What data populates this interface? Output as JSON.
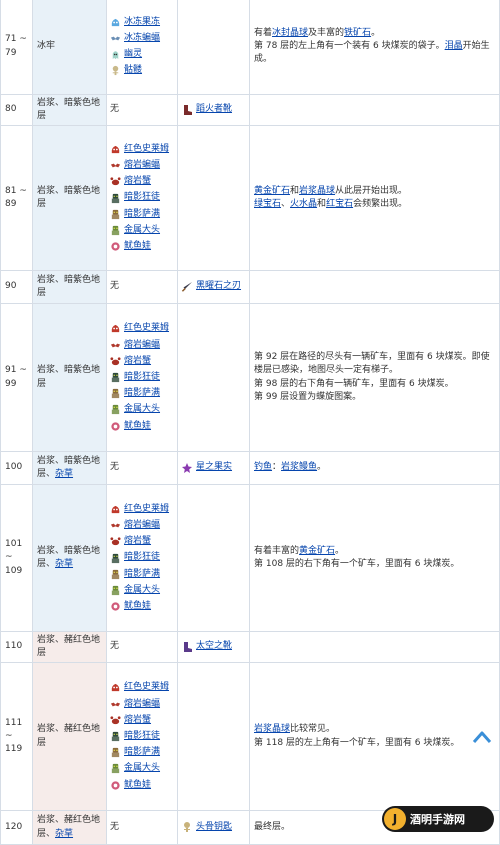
{
  "rows": [
    {
      "floor": "71 ~ 79",
      "layer": "冰牢",
      "layer_links": [],
      "enemies": [
        {
          "icon": "ice-jelly-icon",
          "name": "冰冻果冻",
          "color": "#5aa8e0"
        },
        {
          "icon": "ice-bat-icon",
          "name": "冰冻蝙蝠",
          "color": "#6b8fb5"
        },
        {
          "icon": "ghost-icon",
          "name": "幽灵",
          "color": "#9fd3c8"
        },
        {
          "icon": "skeleton-icon",
          "name": "骷髅",
          "color": "#c9b98a"
        }
      ],
      "item": null,
      "notes": [
        [
          {
            "t": "有着"
          },
          {
            "t": "冰封晶球",
            "link": true
          },
          {
            "t": "及丰富的"
          },
          {
            "t": "铁矿石",
            "link": true
          },
          {
            "t": "。"
          }
        ],
        [
          {
            "t": "第 78 层的左上角有一个装有 6 块煤炭的袋子。"
          },
          {
            "t": "泪晶",
            "link": true
          },
          {
            "t": "开始生成。"
          }
        ]
      ]
    },
    {
      "floor": "80",
      "layer": "岩浆、暗紫色地层",
      "layer_links": [],
      "enemies": [],
      "none_text": "无",
      "item": {
        "icon": "fire-boots-icon",
        "name": "蹈火者靴",
        "color": "#7a2a2a"
      },
      "notes": []
    },
    {
      "floor": "81 ~ 89",
      "layer": "岩浆、暗紫色地层",
      "layer_links": [],
      "enemies": [
        {
          "icon": "red-slime-icon",
          "name": "红色史莱姆",
          "color": "#c0392b"
        },
        {
          "icon": "lava-bat-icon",
          "name": "熔岩蝙蝠",
          "color": "#b03a2e"
        },
        {
          "icon": "lava-crab-icon",
          "name": "熔岩蟹",
          "color": "#a93226"
        },
        {
          "icon": "shadow-brute-icon",
          "name": "暗影狂徒",
          "color": "#2e4a3a"
        },
        {
          "icon": "shadow-shaman-icon",
          "name": "暗影萨满",
          "color": "#8a6a3a"
        },
        {
          "icon": "metal-head-icon",
          "name": "金属大头",
          "color": "#6a8a3a"
        },
        {
          "icon": "squidkid-icon",
          "name": "鱿鱼娃",
          "color": "#d05a7a"
        }
      ],
      "item": null,
      "notes": [
        [
          {
            "t": "黄金矿石",
            "link": true
          },
          {
            "t": "和"
          },
          {
            "t": "岩浆晶球",
            "link": true
          },
          {
            "t": "从此层开始出现。"
          }
        ],
        [
          {
            "t": "绿宝石",
            "link": true
          },
          {
            "t": "、"
          },
          {
            "t": "火水晶",
            "link": true
          },
          {
            "t": "和"
          },
          {
            "t": "红宝石",
            "link": true
          },
          {
            "t": "会频繁出现。"
          }
        ]
      ]
    },
    {
      "floor": "90",
      "layer": "岩浆、暗紫色地层",
      "layer_links": [],
      "enemies": [],
      "none_text": "无",
      "item": {
        "icon": "obsidian-blade-icon",
        "name": "黑曜石之刃",
        "color": "#3a3a4a"
      },
      "notes": []
    },
    {
      "floor": "91 ~ 99",
      "layer": "岩浆、暗紫色地层",
      "layer_links": [],
      "enemies": [
        {
          "icon": "red-slime-icon",
          "name": "红色史莱姆",
          "color": "#c0392b"
        },
        {
          "icon": "lava-bat-icon",
          "name": "熔岩蝙蝠",
          "color": "#b03a2e"
        },
        {
          "icon": "lava-crab-icon",
          "name": "熔岩蟹",
          "color": "#a93226"
        },
        {
          "icon": "shadow-brute-icon",
          "name": "暗影狂徒",
          "color": "#2e4a3a"
        },
        {
          "icon": "shadow-shaman-icon",
          "name": "暗影萨满",
          "color": "#8a6a3a"
        },
        {
          "icon": "metal-head-icon",
          "name": "金属大头",
          "color": "#6a8a3a"
        },
        {
          "icon": "squidkid-icon",
          "name": "鱿鱼娃",
          "color": "#d05a7a"
        }
      ],
      "item": null,
      "notes": [
        [
          {
            "t": "第 92 层在路径的尽头有一辆矿车，里面有 6 块煤炭。即使楼层已感染，地图尽头一定有梯子。"
          }
        ],
        [
          {
            "t": "第 98 层的右下角有一辆矿车，里面有 6 块煤炭。"
          }
        ],
        [
          {
            "t": "第 99 层设置为蝶旋图案。"
          }
        ]
      ]
    },
    {
      "floor": "100",
      "layer": "岩浆、暗紫色地层、",
      "layer_links": [
        "杂草"
      ],
      "enemies": [],
      "none_text": "无",
      "item": {
        "icon": "stardrop-icon",
        "name": "星之果实",
        "color": "#8a3ab0"
      },
      "notes": [
        [
          {
            "t": "钓鱼",
            "link": true
          },
          {
            "t": "："
          },
          {
            "t": "岩浆鳗鱼",
            "link": true
          },
          {
            "t": "。"
          }
        ]
      ]
    },
    {
      "floor": "101 ~ 109",
      "layer": "岩浆、暗紫色地层、",
      "layer_links": [
        "杂草"
      ],
      "enemies": [
        {
          "icon": "red-slime-icon",
          "name": "红色史莱姆",
          "color": "#c0392b"
        },
        {
          "icon": "lava-bat-icon",
          "name": "熔岩蝙蝠",
          "color": "#b03a2e"
        },
        {
          "icon": "lava-crab-icon",
          "name": "熔岩蟹",
          "color": "#a93226"
        },
        {
          "icon": "shadow-brute-icon",
          "name": "暗影狂徒",
          "color": "#2e4a3a"
        },
        {
          "icon": "shadow-shaman-icon",
          "name": "暗影萨满",
          "color": "#8a6a3a"
        },
        {
          "icon": "metal-head-icon",
          "name": "金属大头",
          "color": "#6a8a3a"
        },
        {
          "icon": "squidkid-icon",
          "name": "鱿鱼娃",
          "color": "#d05a7a"
        }
      ],
      "item": null,
      "notes": [
        [
          {
            "t": "有着丰富的"
          },
          {
            "t": "黄金矿石",
            "link": true
          },
          {
            "t": "。"
          }
        ],
        [
          {
            "t": "第 108 层的右下角有一个矿车，里面有 6 块煤炭。"
          }
        ]
      ]
    },
    {
      "floor": "110",
      "layer": "岩浆、赭红色地层",
      "layer_links": [],
      "pink": true,
      "enemies": [],
      "none_text": "无",
      "item": {
        "icon": "space-boots-icon",
        "name": "太空之靴",
        "color": "#5a3a8a"
      },
      "notes": []
    },
    {
      "floor": "111 ~ 119",
      "layer": "岩浆、赭红色地层",
      "layer_links": [],
      "pink": true,
      "enemies": [
        {
          "icon": "red-slime-icon",
          "name": "红色史莱姆",
          "color": "#c0392b"
        },
        {
          "icon": "lava-bat-icon",
          "name": "熔岩蝙蝠",
          "color": "#b03a2e"
        },
        {
          "icon": "lava-crab-icon",
          "name": "熔岩蟹",
          "color": "#a93226"
        },
        {
          "icon": "shadow-brute-icon",
          "name": "暗影狂徒",
          "color": "#2e4a3a"
        },
        {
          "icon": "shadow-shaman-icon",
          "name": "暗影萨满",
          "color": "#8a6a3a"
        },
        {
          "icon": "metal-head-icon",
          "name": "金属大头",
          "color": "#6a8a3a"
        },
        {
          "icon": "squidkid-icon",
          "name": "鱿鱼娃",
          "color": "#d05a7a"
        }
      ],
      "item": null,
      "notes": [
        [
          {
            "t": "岩浆晶球",
            "link": true
          },
          {
            "t": "比较常见。"
          }
        ],
        [
          {
            "t": "第 118 层的左上角有一个矿车，里面有 6 块煤炭。"
          }
        ]
      ]
    },
    {
      "floor": "120",
      "layer": "岩浆、赭红色地层、",
      "layer_links": [
        "杂草"
      ],
      "pink": true,
      "enemies": [],
      "none_text": "无",
      "item": {
        "icon": "skull-key-icon",
        "name": "头骨钥匙",
        "color": "#c8b27a"
      },
      "notes": [
        [
          {
            "t": "最终层。"
          }
        ]
      ]
    }
  ],
  "watermark": {
    "text": "酒明手游网"
  }
}
